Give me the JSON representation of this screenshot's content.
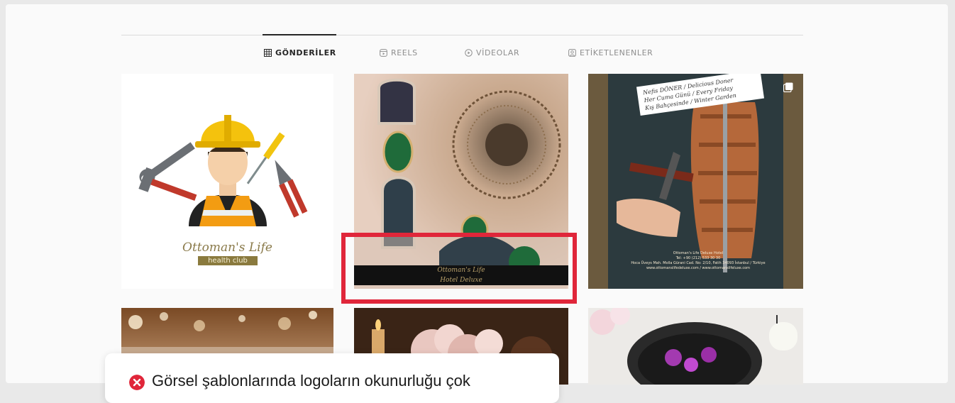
{
  "tabs": [
    {
      "label": "GÖNDERİLER",
      "icon": "grid-icon",
      "active": true
    },
    {
      "label": "REELS",
      "icon": "reels-icon",
      "active": false
    },
    {
      "label": "VİDEOLAR",
      "icon": "play-circle-icon",
      "active": false
    },
    {
      "label": "ETİKETLENENLER",
      "icon": "tagged-person-icon",
      "active": false
    }
  ],
  "posts": {
    "p1": {
      "brand_name": "Ottoman's Life",
      "brand_sub": "health club"
    },
    "p2": {
      "logo_text_1": "Ottoman's Life",
      "logo_text_2": "Hotel Deluxe"
    },
    "p3": {
      "promo_line_1": "Nefis DÖNER / Delicious Doner",
      "promo_line_2": "Her Cuma Günü / Every Friday",
      "promo_line_3": "Kış Bahçesinde / Winter Garden",
      "footer_line_1": "Ottoman's Life Deluxe Hotel",
      "footer_line_2": "Tel: +90 (212) 533 30 30",
      "footer_line_3": "Hoca Üveys Mah. Molla Gürani Cad. No: 2/10, Fatih 34093 İstanbul / Türkiye",
      "footer_line_4": "www.ottomanslifedeluxe.com / www.ottomanslifeluxe.com"
    }
  },
  "toast": {
    "icon": "error-x-icon",
    "message": "Görsel şablonlarında logoların okunurluğu çok"
  },
  "colors": {
    "highlight": "#e0263a",
    "active_tab": "#262626",
    "inactive_tab": "#8e8e8e"
  }
}
